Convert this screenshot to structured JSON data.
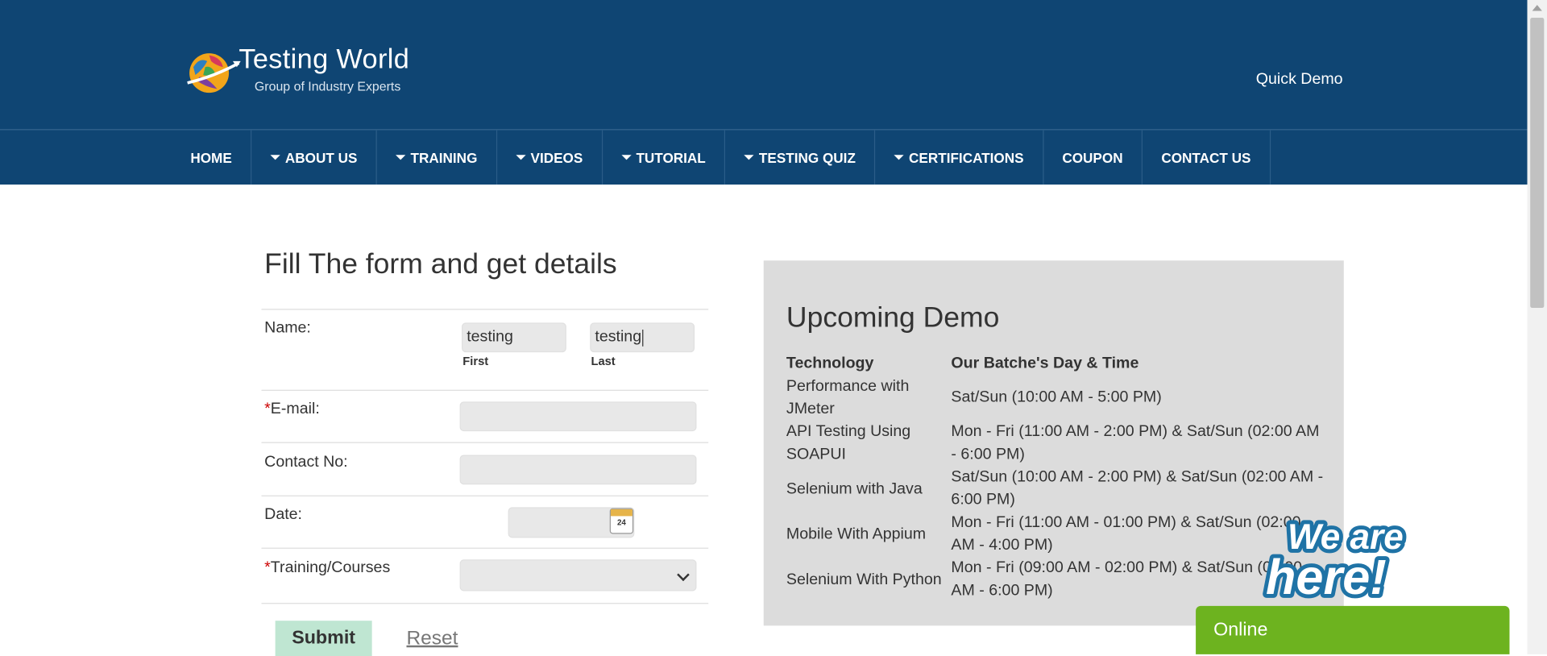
{
  "header": {
    "logo_title": "Testing World",
    "logo_subtitle": "Group of Industry Experts",
    "quick_demo": "Quick Demo"
  },
  "nav": {
    "items": [
      {
        "label": "HOME",
        "dropdown": false
      },
      {
        "label": "ABOUT US",
        "dropdown": true
      },
      {
        "label": "TRAINING",
        "dropdown": true
      },
      {
        "label": "VIDEOS",
        "dropdown": true
      },
      {
        "label": "TUTORIAL",
        "dropdown": true
      },
      {
        "label": "TESTING QUIZ",
        "dropdown": true
      },
      {
        "label": "CERTIFICATIONS",
        "dropdown": true
      },
      {
        "label": "COUPON",
        "dropdown": false
      },
      {
        "label": "CONTACT US",
        "dropdown": false
      }
    ]
  },
  "form": {
    "title": "Fill The form and get details",
    "name_label": "Name:",
    "first_value": "testing",
    "first_sub": "First",
    "last_value": "testing",
    "last_sub": "Last",
    "required_mark": "*",
    "email_label": "E-mail:",
    "email_value": "",
    "contact_label": "Contact No:",
    "contact_value": "",
    "date_label": "Date:",
    "date_value": "",
    "calendar_day": "24",
    "course_label": "Training/Courses",
    "course_value": "",
    "submit_label": "Submit",
    "reset_label": "Reset"
  },
  "demo": {
    "title": "Upcoming Demo",
    "col_technology": "Technology",
    "col_time": "Our Batche's Day & Time",
    "rows": [
      {
        "technology": "Performance with JMeter",
        "time": "Sat/Sun (10:00 AM - 5:00 PM)"
      },
      {
        "technology": "API Testing Using SOAPUI",
        "time": "Mon - Fri (11:00 AM - 2:00 PM) & Sat/Sun (02:00 AM - 6:00 PM)"
      },
      {
        "technology": "Selenium with Java",
        "time": "Sat/Sun (10:00 AM - 2:00 PM) & Sat/Sun (02:00 AM - 6:00 PM)"
      },
      {
        "technology": "Mobile With Appium",
        "time": "Mon - Fri (11:00 AM - 01:00 PM) & Sat/Sun (02:00 AM - 4:00 PM)"
      },
      {
        "technology": "Selenium With Python",
        "time": "Mon - Fri (09:00 AM - 02:00 PM) & Sat/Sun (02:00 AM - 6:00 PM)"
      }
    ]
  },
  "chat": {
    "badge_line1": "We are",
    "badge_line2": "here!",
    "status": "Online"
  },
  "colors": {
    "header_bg": "#0f4573",
    "panel_bg": "#dcdcdc",
    "online_bg": "#6db31f",
    "submit_bg": "#bfe6d2"
  }
}
